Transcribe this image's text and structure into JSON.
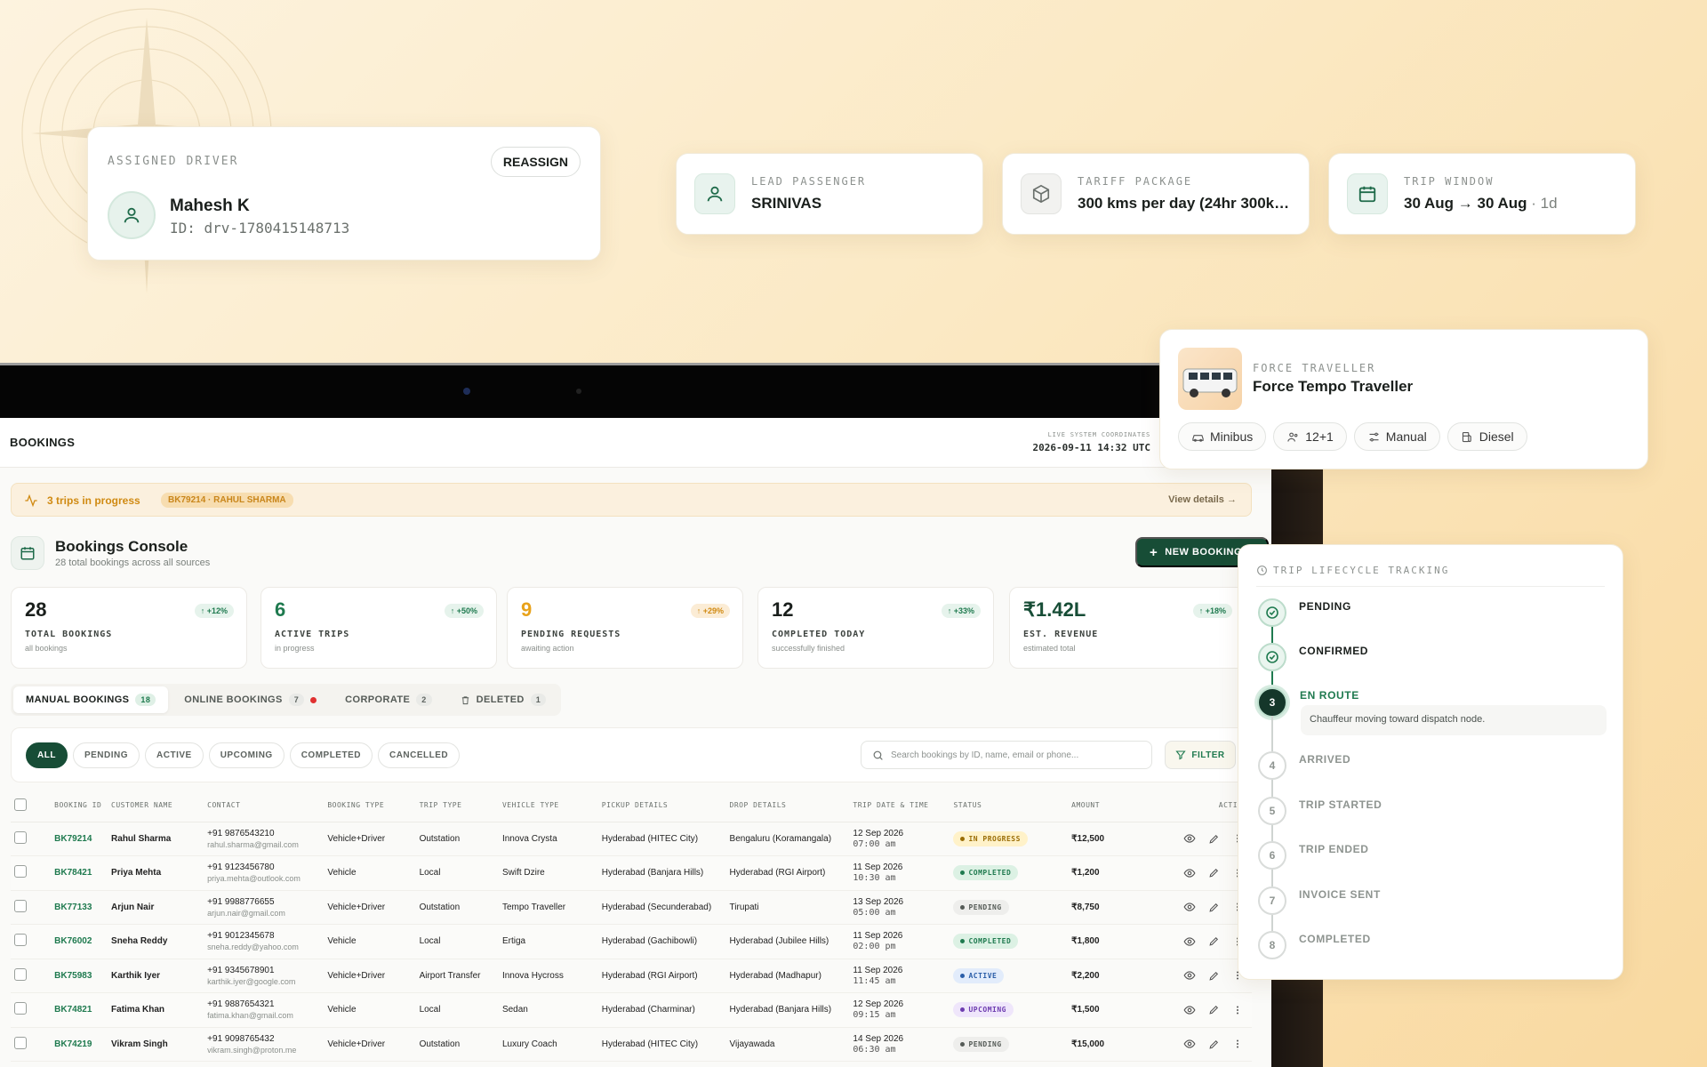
{
  "driver_card": {
    "label": "ASSIGNED DRIVER",
    "reassign_label": "REASSIGN",
    "name": "Mahesh K",
    "id_text": "ID: drv-1780415148713"
  },
  "info_cards": [
    {
      "label": "LEAD PASSENGER",
      "value": "SRINIVAS",
      "sub": "",
      "icon": "user-icon"
    },
    {
      "label": "TARIFF PACKAGE",
      "value": "300 kms per day (24hr 300km…",
      "sub": "",
      "icon": "package-icon"
    },
    {
      "label": "TRIP WINDOW",
      "value": "30 Aug → 30 Aug",
      "sub": " · 1d",
      "icon": "calendar-icon"
    }
  ],
  "vehicle_card": {
    "label": "FORCE TRAVELLER",
    "name": "Force Tempo Traveller",
    "chips": [
      {
        "text": "Minibus",
        "icon": "car-icon"
      },
      {
        "text": "12+1",
        "icon": "users-icon"
      },
      {
        "text": "Manual",
        "icon": "gears-icon"
      },
      {
        "text": "Diesel",
        "icon": "fuel-icon"
      }
    ]
  },
  "lifecycle": {
    "title": "TRIP LIFECYCLE TRACKING",
    "current_note": "Chauffeur moving toward dispatch node.",
    "steps": [
      {
        "n": "1",
        "label": "PENDING",
        "state": "done"
      },
      {
        "n": "2",
        "label": "CONFIRMED",
        "state": "done"
      },
      {
        "n": "3",
        "label": "EN ROUTE",
        "state": "current"
      },
      {
        "n": "4",
        "label": "ARRIVED",
        "state": "pending"
      },
      {
        "n": "5",
        "label": "TRIP STARTED",
        "state": "pending"
      },
      {
        "n": "6",
        "label": "TRIP ENDED",
        "state": "pending"
      },
      {
        "n": "7",
        "label": "INVOICE SENT",
        "state": "pending"
      },
      {
        "n": "8",
        "label": "COMPLETED",
        "state": "pending"
      }
    ]
  },
  "app": {
    "top_title": "BOOKINGS",
    "coord_label": "LIVE SYSTEM COORDINATES",
    "coord_value": "2026-09-11 14:32 UTC",
    "alert": {
      "text": "3 trips in progress",
      "badge": "BK79214 · RAHUL SHARMA",
      "link": "View details"
    },
    "console_title": "Bookings Console",
    "console_sub": "28 total bookings across all sources",
    "new_booking_label": "NEW BOOKING",
    "kpis": [
      {
        "value": "28",
        "label": "TOTAL BOOKINGS",
        "sub": "all bookings",
        "delta": "↑ +12%",
        "value_color": "#1a1f1c",
        "delta_tone": "green"
      },
      {
        "value": "6",
        "label": "ACTIVE TRIPS",
        "sub": "in progress",
        "delta": "↑ +50%",
        "value_color": "#1f7a4f",
        "delta_tone": "green"
      },
      {
        "value": "9",
        "label": "PENDING REQUESTS",
        "sub": "awaiting action",
        "delta": "↑ +29%",
        "value_color": "#e8a21a",
        "delta_tone": "orange"
      },
      {
        "value": "12",
        "label": "COMPLETED TODAY",
        "sub": "successfully finished",
        "delta": "↑ +33%",
        "value_color": "#1a1f1c",
        "delta_tone": "green"
      },
      {
        "value": "₹1.42L",
        "label": "EST. REVENUE",
        "sub": "estimated total",
        "delta": "↑ +18%",
        "value_color": "#174d36",
        "delta_tone": "green"
      }
    ],
    "tabs": [
      {
        "label": "MANUAL BOOKINGS",
        "count": "18",
        "active": true,
        "dot": false,
        "icon": ""
      },
      {
        "label": "ONLINE BOOKINGS",
        "count": "7",
        "active": false,
        "dot": true,
        "icon": ""
      },
      {
        "label": "CORPORATE",
        "count": "2",
        "active": false,
        "dot": false,
        "icon": ""
      },
      {
        "label": "DELETED",
        "count": "1",
        "active": false,
        "dot": false,
        "icon": "trash-icon"
      }
    ],
    "filters": [
      "ALL",
      "PENDING",
      "ACTIVE",
      "UPCOMING",
      "COMPLETED",
      "CANCELLED"
    ],
    "active_filter": "ALL",
    "search_placeholder": "Search bookings by ID, name, email or phone...",
    "filter_label": "FILTER",
    "columns": [
      "BOOKING ID",
      "CUSTOMER NAME",
      "CONTACT",
      "BOOKING TYPE",
      "TRIP TYPE",
      "VEHICLE TYPE",
      "PICKUP DETAILS",
      "DROP DETAILS",
      "TRIP DATE & TIME",
      "STATUS",
      "AMOUNT",
      "ACTIONS"
    ],
    "rows": [
      {
        "id": "BK79214",
        "name": "Rahul Sharma",
        "phone": "+91 9876543210",
        "email": "rahul.sharma@gmail.com",
        "btype": "Vehicle+Driver",
        "ttype": "Outstation",
        "vtype": "Innova Crysta",
        "pickup": "Hyderabad (HITEC City)",
        "drop": "Bengaluru (Koramangala)",
        "date": "12 Sep 2026",
        "time": "07:00 am",
        "status": "IN PROGRESS",
        "skey": "inprogress",
        "amount": "₹12,500"
      },
      {
        "id": "BK78421",
        "name": "Priya Mehta",
        "phone": "+91 9123456780",
        "email": "priya.mehta@outlook.com",
        "btype": "Vehicle",
        "ttype": "Local",
        "vtype": "Swift Dzire",
        "pickup": "Hyderabad (Banjara Hills)",
        "drop": "Hyderabad (RGI Airport)",
        "date": "11 Sep 2026",
        "time": "10:30 am",
        "status": "COMPLETED",
        "skey": "completed",
        "amount": "₹1,200"
      },
      {
        "id": "BK77133",
        "name": "Arjun Nair",
        "phone": "+91 9988776655",
        "email": "arjun.nair@gmail.com",
        "btype": "Vehicle+Driver",
        "ttype": "Outstation",
        "vtype": "Tempo Traveller",
        "pickup": "Hyderabad (Secunderabad)",
        "drop": "Tirupati",
        "date": "13 Sep 2026",
        "time": "05:00 am",
        "status": "PENDING",
        "skey": "pending",
        "amount": "₹8,750"
      },
      {
        "id": "BK76002",
        "name": "Sneha Reddy",
        "phone": "+91 9012345678",
        "email": "sneha.reddy@yahoo.com",
        "btype": "Vehicle",
        "ttype": "Local",
        "vtype": "Ertiga",
        "pickup": "Hyderabad (Gachibowli)",
        "drop": "Hyderabad (Jubilee Hills)",
        "date": "11 Sep 2026",
        "time": "02:00 pm",
        "status": "COMPLETED",
        "skey": "completed",
        "amount": "₹1,800"
      },
      {
        "id": "BK75983",
        "name": "Karthik Iyer",
        "phone": "+91 9345678901",
        "email": "karthik.iyer@google.com",
        "btype": "Vehicle+Driver",
        "ttype": "Airport Transfer",
        "vtype": "Innova Hycross",
        "pickup": "Hyderabad (RGI Airport)",
        "drop": "Hyderabad (Madhapur)",
        "date": "11 Sep 2026",
        "time": "11:45 am",
        "status": "ACTIVE",
        "skey": "active",
        "amount": "₹2,200"
      },
      {
        "id": "BK74821",
        "name": "Fatima Khan",
        "phone": "+91 9887654321",
        "email": "fatima.khan@gmail.com",
        "btype": "Vehicle",
        "ttype": "Local",
        "vtype": "Sedan",
        "pickup": "Hyderabad (Charminar)",
        "drop": "Hyderabad (Banjara Hills)",
        "date": "12 Sep 2026",
        "time": "09:15 am",
        "status": "UPCOMING",
        "skey": "upcoming",
        "amount": "₹1,500"
      },
      {
        "id": "BK74219",
        "name": "Vikram Singh",
        "phone": "+91 9098765432",
        "email": "vikram.singh@proton.me",
        "btype": "Vehicle+Driver",
        "ttype": "Outstation",
        "vtype": "Luxury Coach",
        "pickup": "Hyderabad (HITEC City)",
        "drop": "Vijayawada",
        "date": "14 Sep 2026",
        "time": "06:30 am",
        "status": "PENDING",
        "skey": "pending",
        "amount": "₹15,000"
      }
    ]
  }
}
